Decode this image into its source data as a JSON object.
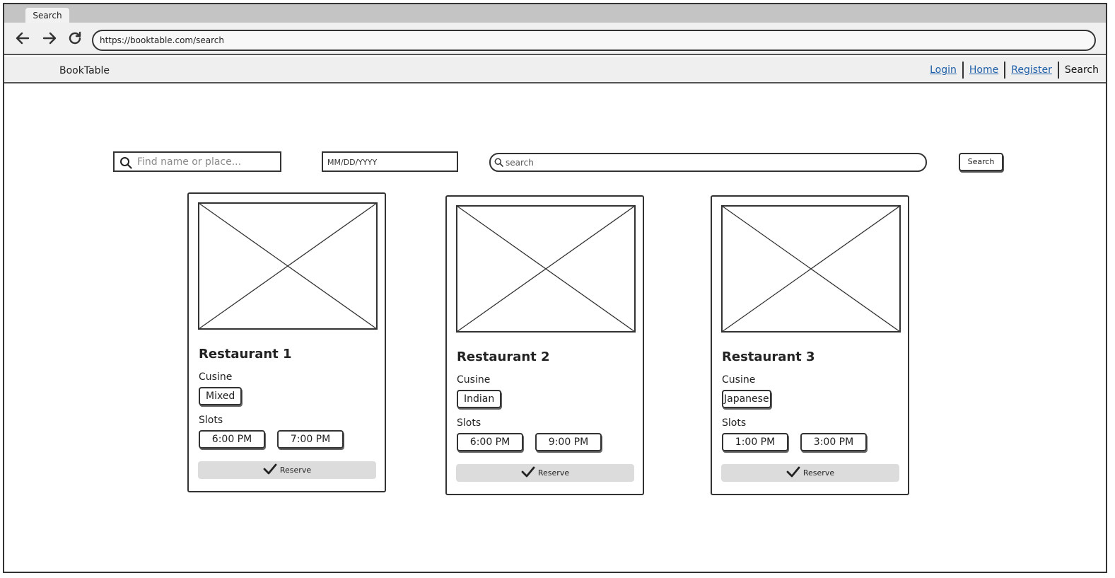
{
  "browser": {
    "tab_title": "Search",
    "url": "https://booktable.com/search",
    "back_icon": "arrow-left-icon",
    "forward_icon": "arrow-right-icon",
    "reload_icon": "reload-icon"
  },
  "header": {
    "brand": "BookTable",
    "nav": [
      {
        "label": "Login",
        "current": false
      },
      {
        "label": "Home",
        "current": false
      },
      {
        "label": "Register",
        "current": false
      },
      {
        "label": "Search",
        "current": true
      }
    ]
  },
  "search_bar": {
    "find_placeholder": "Find name or place...",
    "date_placeholder": "MM/DD/YYYY",
    "search_placeholder": "search",
    "search_button": "Search"
  },
  "restaurants": [
    {
      "name": "Restaurant 1",
      "cuisine_label": "Cusine",
      "cuisine": "Mixed",
      "slots_label": "Slots",
      "slots": [
        "6:00 PM",
        "7:00 PM"
      ],
      "reserve": "Reserve"
    },
    {
      "name": "Restaurant 2",
      "cuisine_label": "Cusine",
      "cuisine": "Indian",
      "slots_label": "Slots",
      "slots": [
        "6:00 PM",
        "9:00 PM"
      ],
      "reserve": "Reserve"
    },
    {
      "name": "Restaurant 3",
      "cuisine_label": "Cusine",
      "cuisine": "Japanese",
      "slots_label": "Slots",
      "slots": [
        "1:00 PM",
        "3:00 PM"
      ],
      "reserve": "Reserve"
    }
  ]
}
